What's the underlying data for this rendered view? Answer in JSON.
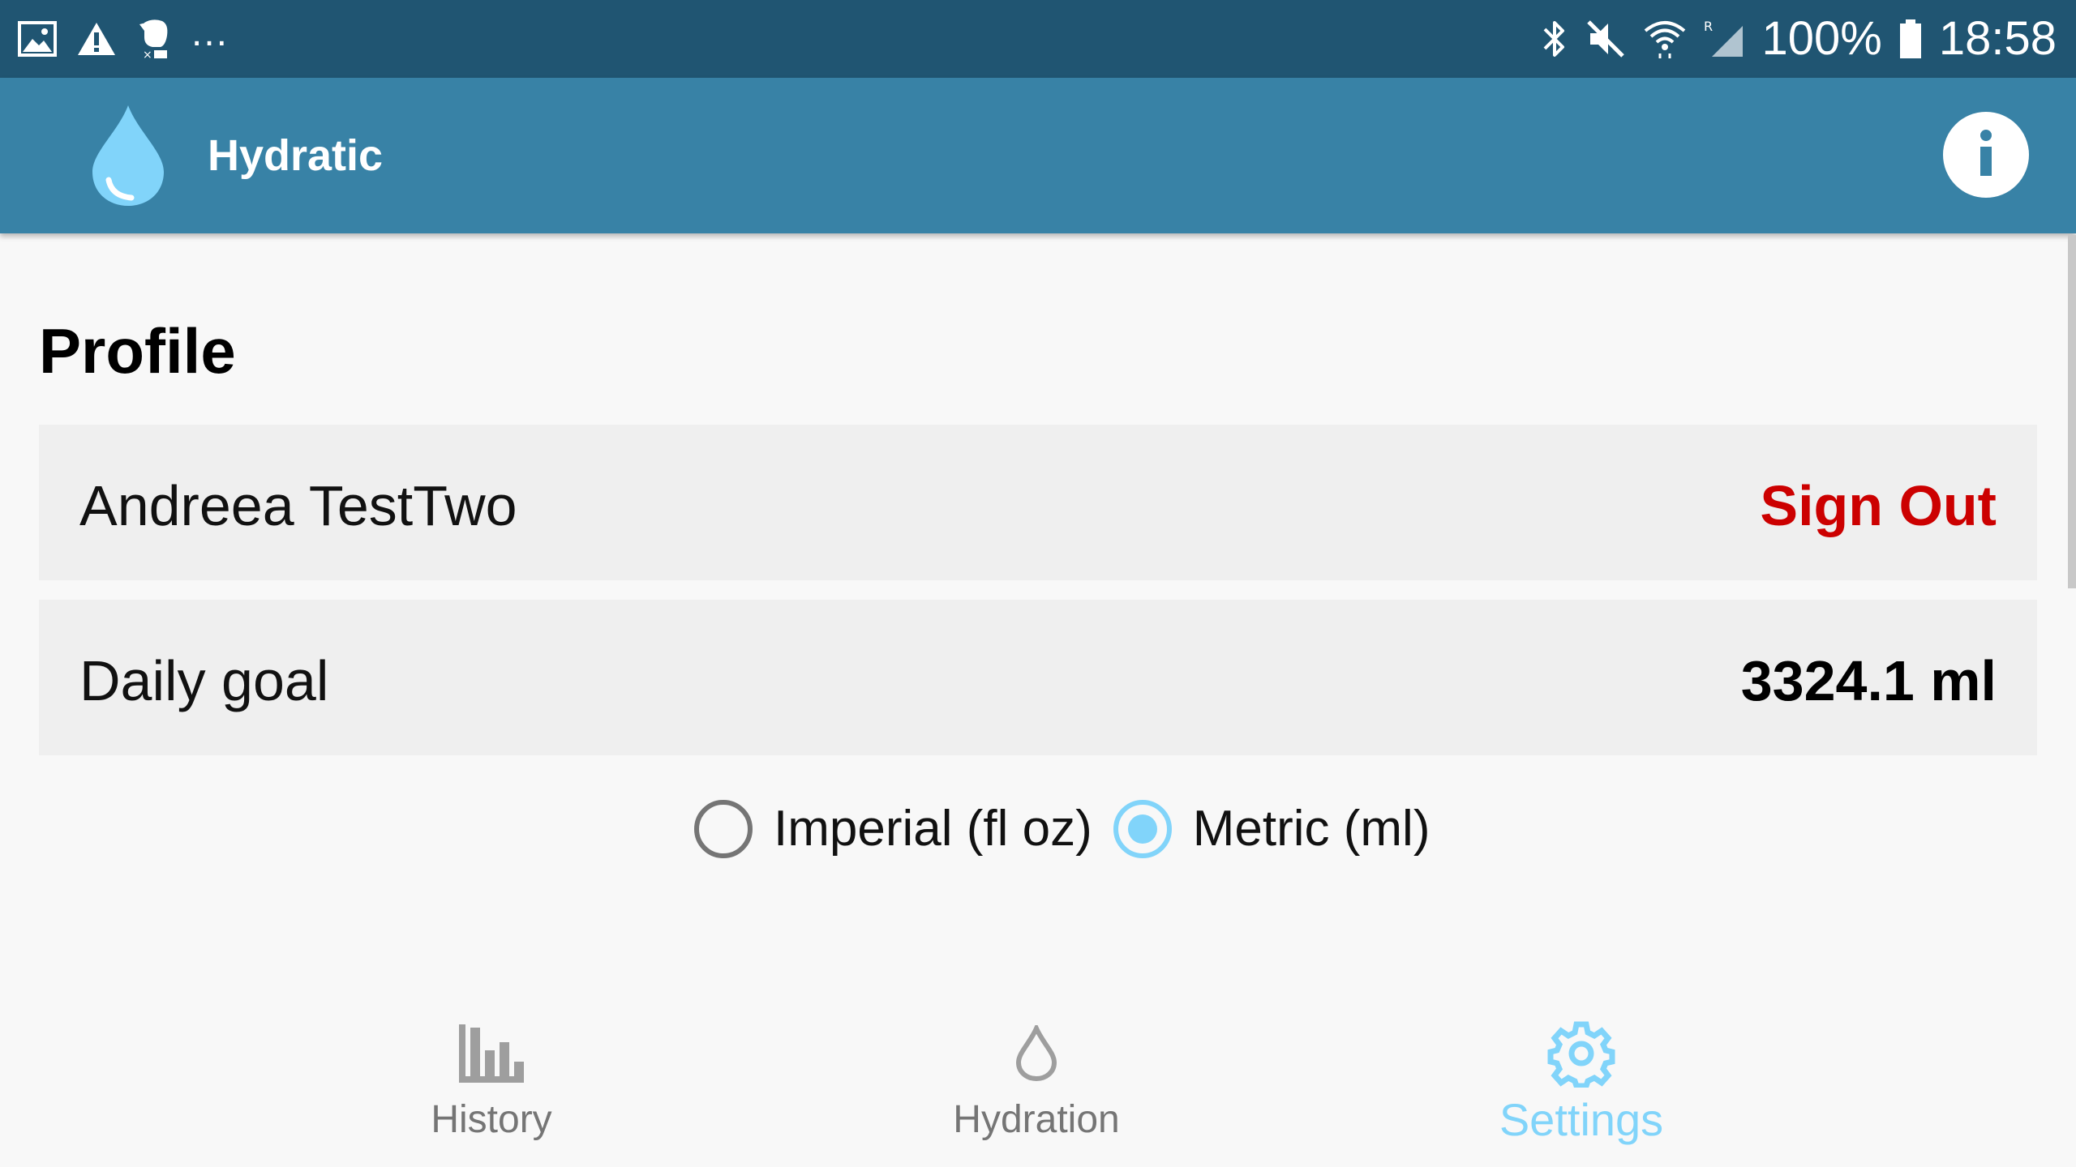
{
  "status_bar": {
    "left_icons": [
      "gallery-icon",
      "warning-icon",
      "evernote-icon"
    ],
    "more": "...",
    "right_icons": [
      "bluetooth-icon",
      "mute-icon",
      "wifi-icon",
      "signal-icon"
    ],
    "battery_text": "100%",
    "battery_icon": "battery-icon",
    "time": "18:58"
  },
  "app_bar": {
    "logo_icon": "water-drop-logo-icon",
    "title": "Hydratic",
    "info_icon": "info-icon"
  },
  "profile": {
    "title": "Profile",
    "name": "Andreea TestTwo",
    "sign_out_label": "Sign Out",
    "daily_goal_label": "Daily goal",
    "daily_goal_value": "3324.1 ml"
  },
  "units": {
    "imperial_label": "Imperial (fl oz)",
    "metric_label": "Metric (ml)",
    "selected": "metric"
  },
  "bottom_nav": {
    "items": [
      {
        "label": "History",
        "icon": "bar-chart-icon",
        "active": false
      },
      {
        "label": "Hydration",
        "icon": "drop-icon",
        "active": false
      },
      {
        "label": "Settings",
        "icon": "gear-icon",
        "active": true
      }
    ]
  },
  "colors": {
    "status_bar": "#205572",
    "app_bar": "#3882a6",
    "sign_out": "#cc0000",
    "accent": "#81d4fa",
    "card_bg": "#efefef",
    "page_bg": "#f8f8f8"
  }
}
